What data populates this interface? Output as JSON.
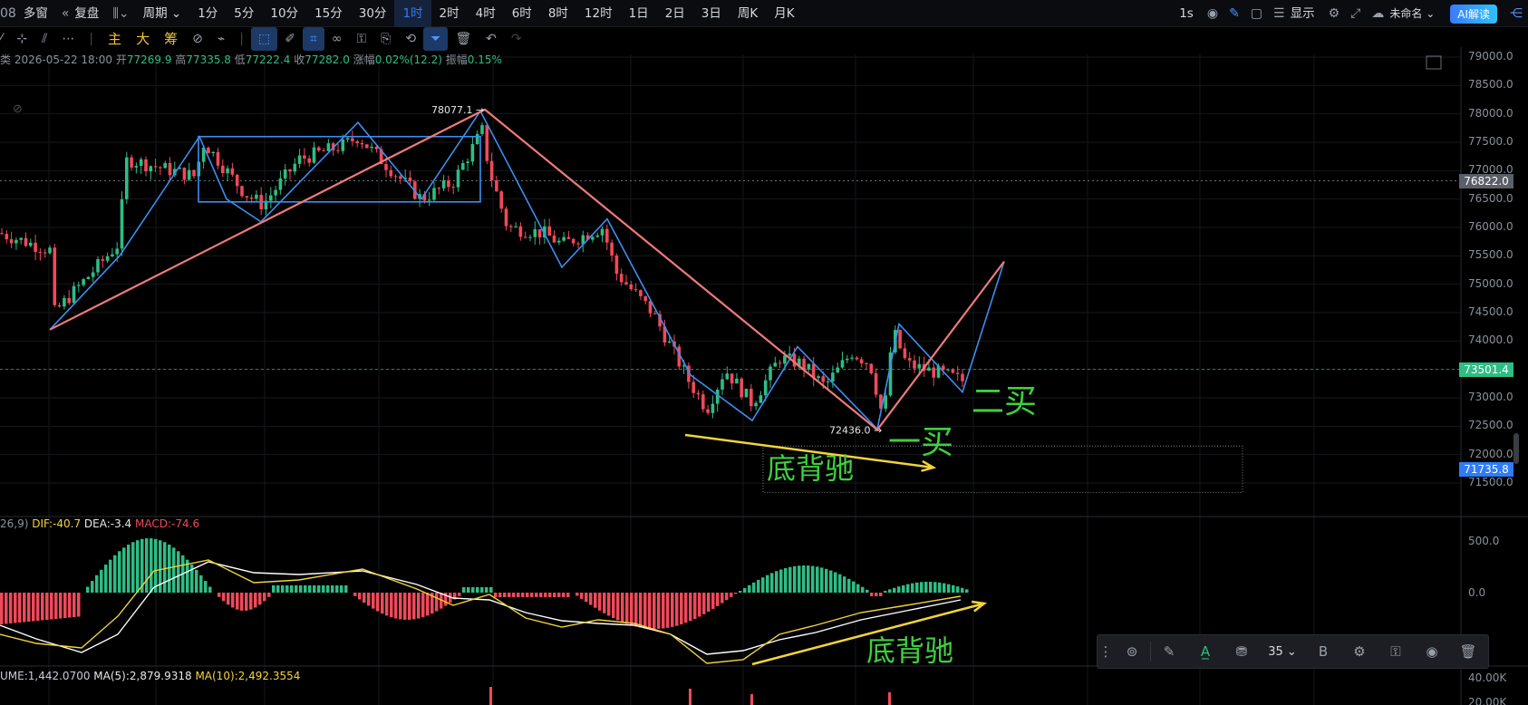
{
  "topbar": {
    "left_items": [
      {
        "label": "多窗",
        "icon": "multi-window-icon"
      },
      {
        "label": "复盘",
        "icon": "replay-icon"
      }
    ],
    "period_label": "周期",
    "intervals": [
      "1分",
      "5分",
      "10分",
      "15分",
      "30分",
      "1时",
      "2时",
      "4时",
      "6时",
      "8时",
      "12时",
      "1日",
      "2日",
      "3日",
      "周K",
      "月K"
    ],
    "active_interval": "1时",
    "right": {
      "refresh": "1s",
      "display_label": "显示",
      "unnamed_label": "未命名",
      "ai_label": "AI解读"
    }
  },
  "toolbar2": {
    "indicators": [
      "主",
      "大",
      "筹"
    ]
  },
  "info": {
    "datetime": "2026-05-22 18:00",
    "open_label": "开",
    "open": "77269.9",
    "high_label": "高",
    "high": "77335.8",
    "low_label": "低",
    "low": "77222.4",
    "close_label": "收",
    "close": "77282.0",
    "change_label": "涨幅",
    "change": "0.02%(12.2)",
    "amplitude_label": "振幅",
    "amplitude": "0.15%"
  },
  "price_axis": {
    "ticks": [
      "79000.0",
      "78500.0",
      "78000.0",
      "77500.0",
      "77000.0",
      "76500.0",
      "76000.0",
      "75500.0",
      "75000.0",
      "74500.0",
      "74000.0",
      "73500.0",
      "73000.0",
      "72500.0",
      "72000.0",
      "71500.0"
    ],
    "current_tag": "73501.4",
    "crosshair_tag": "76822.0",
    "box_tag": "71735.8"
  },
  "annotations": {
    "high_label": "78077.1",
    "low_label": "72436.0",
    "first_buy": "一买",
    "second_buy": "二买",
    "divergence_price": "底背驰",
    "divergence_macd": "底背驰"
  },
  "macd": {
    "params": "26,9)",
    "dif": "DIF:-40.7",
    "dea": "DEA:-3.4",
    "macd": "MACD:-74.6",
    "axis": [
      "500.0",
      "0.0"
    ]
  },
  "volume": {
    "vol": "UME:1,442.0700",
    "ma5": "MA(5):2,879.9318",
    "ma10": "MA(10):2,492.3554",
    "axis": [
      "40.00K",
      "20.00K"
    ]
  },
  "drawbar": {
    "font_size": "35",
    "bold": "B"
  },
  "colors": {
    "up": "#2ebd85",
    "down": "#f0495a",
    "stroke_blue": "#3d8ef0",
    "stroke_pink": "#f07a7a",
    "annotation_green": "#3fcf3f",
    "arrow_yellow": "#f2d43a"
  }
}
